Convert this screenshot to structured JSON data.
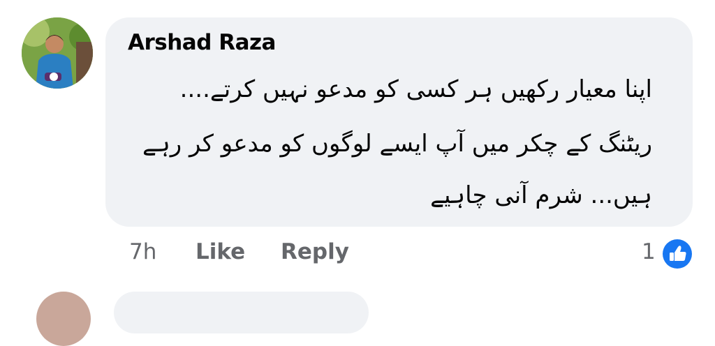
{
  "comment": {
    "author": "Arshad Raza",
    "text_lines": [
      "اپنا معیار رکھیں ہر کسی کو مدعو نہیں کرتے....",
      "ریٹنگ کے چکر میں آپ ایسے لوگوں کو مدعو کر رہے",
      "ہیں... شرم آنی چاہیے"
    ],
    "timestamp": "7h",
    "like_label": "Like",
    "reply_label": "Reply",
    "reaction_count": "1",
    "reaction_icon": "thumbs-up-icon"
  },
  "colors": {
    "bubble_bg": "#f0f2f5",
    "text": "#050505",
    "meta_text": "#65676b",
    "like_blue": "#1877f2"
  }
}
